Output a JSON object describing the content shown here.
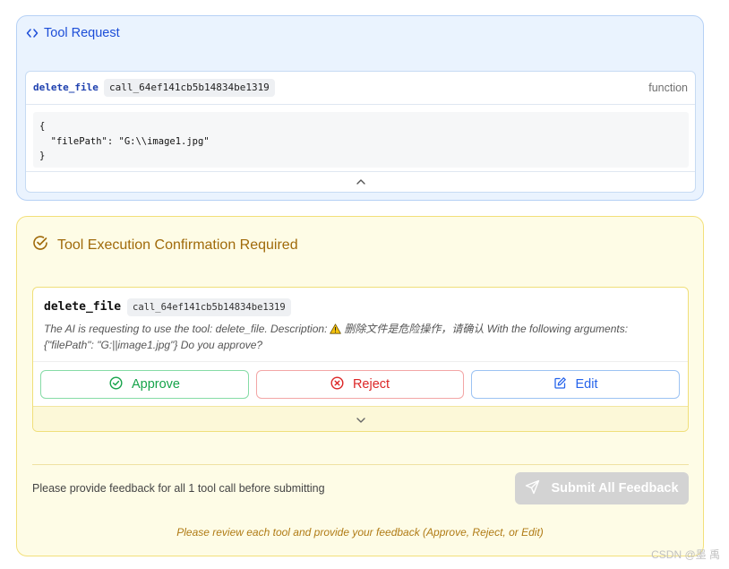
{
  "tool_request": {
    "title": "Tool Request",
    "icon": "code-icon",
    "function_name": "delete_file",
    "call_id": "call_64ef141cb5b14834be1319",
    "type_label": "function",
    "arguments_json": "{\n  \"filePath\": \"G:\\\\image1.jpg\"\n}"
  },
  "confirmation": {
    "title": "Tool Execution Confirmation Required",
    "tool_name": "delete_file",
    "call_id": "call_64ef141cb5b14834be1319",
    "description_before": "The AI is requesting to use the tool: delete_file. Description:",
    "description_after": "删除文件是危险操作，请确认 With the following arguments: {\"filePath\": \"G:||image1.jpg\"} Do you approve?",
    "buttons": {
      "approve": "Approve",
      "reject": "Reject",
      "edit": "Edit"
    },
    "hint": "Please provide feedback for all 1 tool call before submitting",
    "submit_label": "Submit All Feedback",
    "footer_note": "Please review each tool and provide your feedback (Approve, Reject, or Edit)"
  },
  "watermark": "CSDN @墨 禹",
  "colors": {
    "request_accent": "#1d4ed8",
    "warning_accent": "#a06a0a",
    "approve": "#16a34a",
    "reject": "#dc2626",
    "edit": "#2563eb",
    "submit_disabled": "#d3d3d3"
  }
}
